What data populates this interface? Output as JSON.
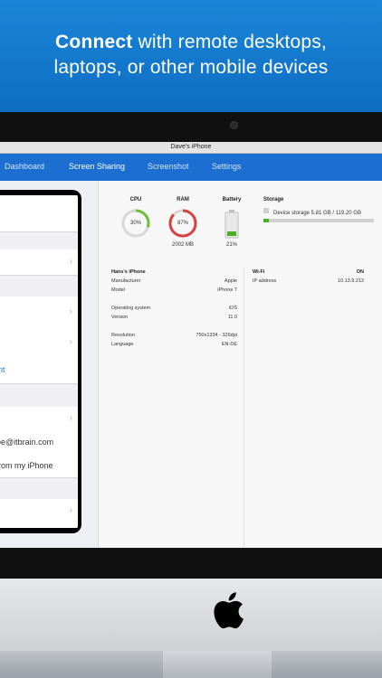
{
  "promo": {
    "line1_bold": "Connect",
    "line1_rest": " with remote desktops,",
    "line2": "laptops, or other mobile devices"
  },
  "window": {
    "title": "Dave's iPhone"
  },
  "nav": {
    "items": [
      {
        "label": "Dashboard",
        "active": false
      },
      {
        "label": "Screen Sharing",
        "active": true
      },
      {
        "label": "Screenshot",
        "active": false
      },
      {
        "label": "Settings",
        "active": false
      }
    ]
  },
  "phone_screen": {
    "texts": {
      "link": "nt",
      "email": "oe@itbrain.com",
      "sent_from": "rom my iPhone"
    }
  },
  "metrics": {
    "cpu": {
      "label": "CPU",
      "percent": 30,
      "value_text": "30%"
    },
    "ram": {
      "label": "RAM",
      "percent": 87,
      "value_text": "87%",
      "sub": "2002 MB"
    },
    "battery": {
      "label": "Battery",
      "percent": 21,
      "value_text": "21%"
    },
    "storage": {
      "label": "Storage",
      "detail": "Device storage 5.81 GB / 119.20 GB",
      "fraction": 0.049
    }
  },
  "device_info": {
    "name": "Hans's iPhone",
    "rows": [
      {
        "label": "Manufacturer",
        "value": "Apple"
      },
      {
        "label": "Model",
        "value": "iPhone 7"
      },
      {
        "label": "Operating system",
        "value": "iOS"
      },
      {
        "label": "Version",
        "value": "11.0"
      },
      {
        "label": "Resolution",
        "value": "750x1334 - 326dpi"
      },
      {
        "label": "Language",
        "value": "EN-DE"
      }
    ]
  },
  "network": {
    "title": "Wi-Fi",
    "status": "ON",
    "ip_label": "IP address",
    "ip_value": "10.13.9.213"
  },
  "colors": {
    "accent": "#1c6fd0",
    "cpu": "#6cc13b",
    "ram": "#d64242",
    "battery": "#4caf1f",
    "link": "#1a7ad6"
  }
}
